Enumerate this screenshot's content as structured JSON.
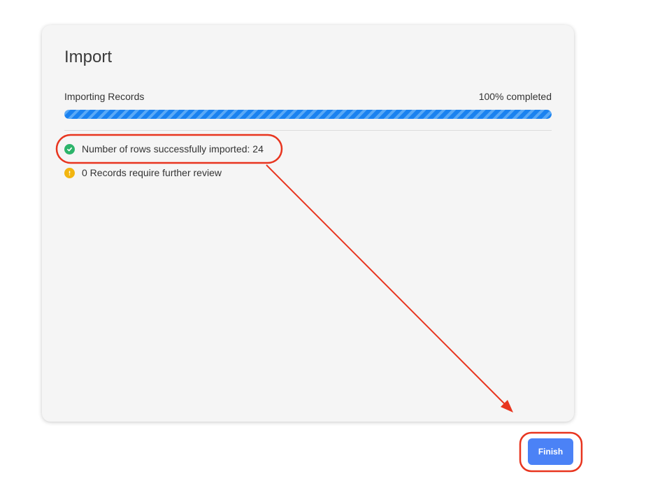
{
  "dialog": {
    "title": "Import",
    "progress": {
      "label": "Importing Records",
      "status": "100% completed",
      "percent": 100
    },
    "results": {
      "success_text": "Number of rows successfully imported: 24",
      "success_icon": "check-circle-icon",
      "review_text": "0 Records require further review",
      "review_icon": "warning-circle-icon"
    }
  },
  "footer": {
    "finish_label": "Finish"
  },
  "colors": {
    "progress_fill": "#1a82f0",
    "success": "#2cb46a",
    "warning": "#f2b50f",
    "button": "#4b82f6",
    "annotation": "#e8351f"
  }
}
